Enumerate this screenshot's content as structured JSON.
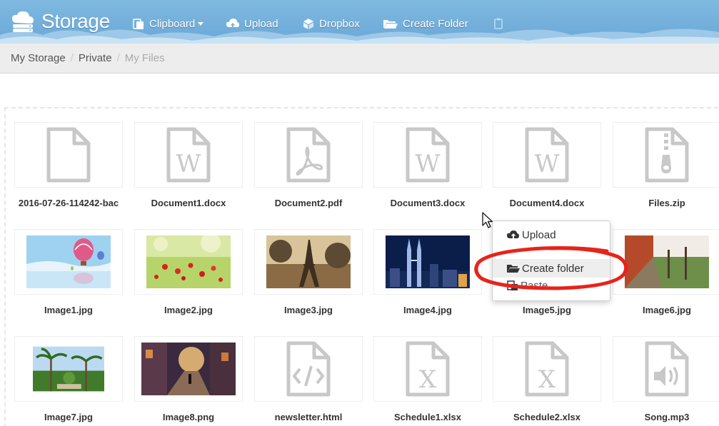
{
  "app": {
    "title": "Storage"
  },
  "nav": {
    "clipboard": "Clipboard",
    "upload": "Upload",
    "dropbox": "Dropbox",
    "create_folder": "Create Folder"
  },
  "breadcrumb": [
    "My Storage",
    "Private",
    "My Files"
  ],
  "files": [
    {
      "name": "2016-07-26-114242-bac",
      "icon": "file-icon"
    },
    {
      "name": "Document1.docx",
      "icon": "word-file-icon"
    },
    {
      "name": "Document2.pdf",
      "icon": "pdf-file-icon"
    },
    {
      "name": "Document3.docx",
      "icon": "word-file-icon"
    },
    {
      "name": "Document4.docx",
      "icon": "word-file-icon"
    },
    {
      "name": "Files.zip",
      "icon": "zip-file-icon"
    },
    {
      "name": "Image1.jpg",
      "icon": "balloons-thumbnail"
    },
    {
      "name": "Image2.jpg",
      "icon": "flowers-thumbnail"
    },
    {
      "name": "Image3.jpg",
      "icon": "eiffel-tower-thumbnail"
    },
    {
      "name": "Image4.jpg",
      "icon": "city-night-thumbnail"
    },
    {
      "name": "Image5.jpg",
      "icon": "image-thumbnail"
    },
    {
      "name": "Image6.jpg",
      "icon": "garden-thumbnail"
    },
    {
      "name": "Image7.jpg",
      "icon": "palm-garden-thumbnail"
    },
    {
      "name": "Image8.png",
      "icon": "street-thumbnail"
    },
    {
      "name": "newsletter.html",
      "icon": "code-file-icon"
    },
    {
      "name": "Schedule1.xlsx",
      "icon": "excel-file-icon"
    },
    {
      "name": "Schedule2.xlsx",
      "icon": "excel-file-icon"
    },
    {
      "name": "Song.mp3",
      "icon": "audio-file-icon"
    }
  ],
  "context_menu": {
    "items": [
      {
        "label": "Upload",
        "icon": "cloud-upload-icon"
      },
      {
        "label": "Create folder",
        "icon": "folder-open-icon"
      },
      {
        "label": "Paste",
        "icon": "paste-icon"
      }
    ]
  },
  "colors": {
    "header": "#6ba8d6",
    "annotation": "#e8231a",
    "file_icon": "#c8c8c8"
  }
}
